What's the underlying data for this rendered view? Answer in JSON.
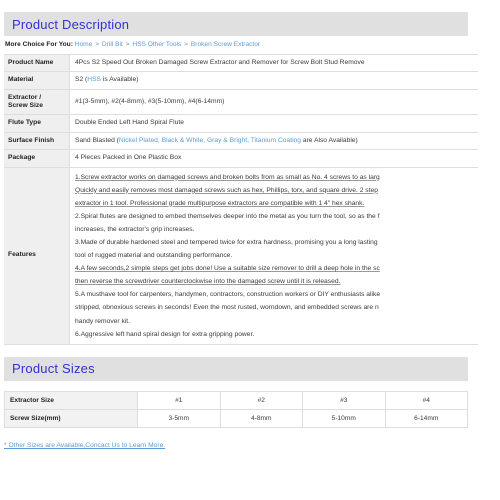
{
  "sections": {
    "description_title": "Product Description",
    "sizes_title": "Product Sizes"
  },
  "breadcrumb": {
    "label": "More Choice For You:",
    "separator": ">",
    "items": [
      {
        "text": "Home"
      },
      {
        "text": "Drill Bit"
      },
      {
        "text": "HSS Other Tools"
      },
      {
        "text": "Broken Screw Extractor"
      }
    ]
  },
  "spec_table": {
    "rows": [
      {
        "key": "Product Name",
        "value": "4Pcs S2 Speed Out Broken Damaged Screw Extractor and Remover for Screw Bolt Stud Remove"
      },
      {
        "key": "Material",
        "value_prefix": "S2 (",
        "value_link": "HSS",
        "value_suffix": " is Available)"
      },
      {
        "key": "Extractor / Screw Size",
        "key_line1": "Extractor /",
        "key_line2": "Screw Size",
        "value": "#1(3-5mm), #2(4-8mm), #3(5-10mm), #4(6-14mm)"
      },
      {
        "key": "Flute Type",
        "value": "Double Ended Left Hand Spiral Flute"
      },
      {
        "key": "Surface Finish",
        "value_prefix": "Sand Blasted (",
        "value_link": "Nickel Plated, Black & White, Gray & Bright, Titanium Coating",
        "value_suffix": " are Also  Available)"
      },
      {
        "key": "Package",
        "value": "4 Pieces Packed in One Plastic Box"
      }
    ],
    "features_key": "Features",
    "features_lines": [
      {
        "text": "1.Screw extractor works on damaged screws and broken bolts from as small as No. 4 screws to as larg",
        "underline": true
      },
      {
        "text": "Quickly and easily removes most damaged screws such as hex, Phillips, torx, and square drive. 2 step",
        "underline": true
      },
      {
        "text": "extractor in 1 tool. Professional grade multipurpose extractors are compatible with 1 4\" hex shank.",
        "underline": true
      },
      {
        "text": "2.Spiral flutes are designed to embed themselves deeper into the metal as you turn the tool, so as the f",
        "underline": false
      },
      {
        "text": "increases, the extractor's grip increases.",
        "underline": false
      },
      {
        "text": "3.Made of durable hardened steel and tempered twice for extra hardness, promising you a long lasting",
        "underline": false
      },
      {
        "text": "tool of rugged material and outstanding performance.",
        "underline": false
      },
      {
        "text": "4.A few seconds,2 simple steps get jobs done! Use a suitable size remover to drill a deep hole in the sc",
        "underline": true
      },
      {
        "text": "then reverse the screwdriver counterclockwise into the damaged screw until it is released.",
        "underline": true
      },
      {
        "text": "5.A musthave tool for carpenters, handymen, contractors, construction workers or DIY enthusiasts alike",
        "underline": false
      },
      {
        "text": "stripped, obnoxious screws in seconds! Even the most rusted, worndown, and embedded screws are n",
        "underline": false
      },
      {
        "text": "handy remover kit.",
        "underline": false
      },
      {
        "text": "6.Aggressive left hand spiral design for extra gripping power.",
        "underline": false
      }
    ]
  },
  "sizes_table": {
    "rows": [
      {
        "header": "Extractor Size",
        "cells": [
          "#1",
          "#2",
          "#3",
          "#4"
        ]
      },
      {
        "header": "Screw Size(mm)",
        "cells": [
          "3-5mm",
          "4-8mm",
          "5-10mm",
          "6-14mm"
        ]
      }
    ]
  },
  "footnote": {
    "text": "* Other Sizes are Available,Concact Us to Learn More."
  },
  "colors": {
    "section_title": "#3333cc",
    "section_bar_bg": "#e0e0e0",
    "link": "#5b9bd5",
    "key_cell_bg": "#efefef",
    "border": "#dddddd"
  }
}
